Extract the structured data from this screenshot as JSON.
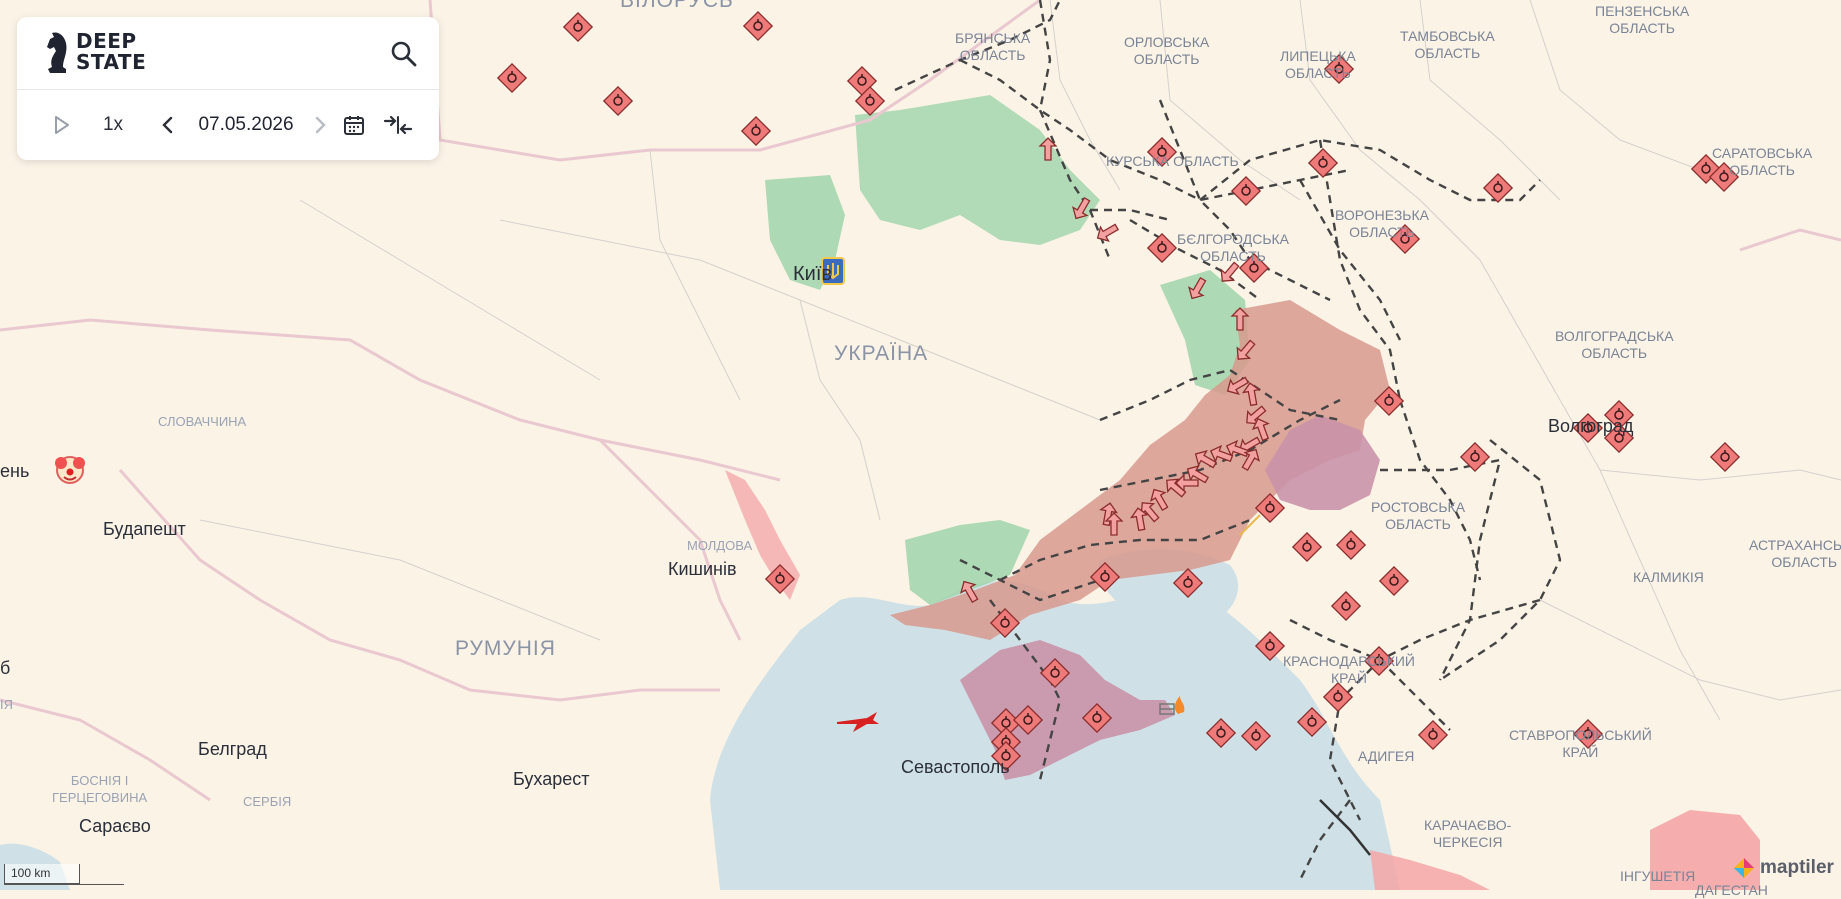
{
  "app": {
    "logo_line1": "DEEP",
    "logo_line2": "STATE"
  },
  "controls": {
    "speed": "1x",
    "date": "07.05.2026"
  },
  "labels": {
    "belarus": "ВІЛОРУСЬ",
    "bryansk": "БРЯНСЬКА\nОБЛАСТЬ",
    "orel": "ОРЛОВСЬКА\nОБЛАСТЬ",
    "lipetsk": "ЛИПЕЦЬКА\nОБЛАСТЬ",
    "tambov": "ТАМБОВСЬКА\nОБЛАСТЬ",
    "penza": "ПЕНЗЕНСЬКА\nОБЛАСТЬ",
    "kursk": "КУРСЬКА ОБЛАСТЬ",
    "saratov": "САРАТОВСЬКА\nОБЛАСТЬ",
    "voronezh": "ВОРОНЕЗЬКА\nОБЛАСТЬ",
    "belgorod": "БЄЛГОРОДСЬКА\nОБЛАСТЬ",
    "kyiv": "Київ",
    "ukraine": "УКРАЇНА",
    "volgograd_obl": "ВОЛГОГРАДСЬКА\nОБЛАСТЬ",
    "volgograd": "Волгоград",
    "slovakia": "СЛОВАЧЧИНА",
    "budapest": "Будапешт",
    "moldova": "МОЛДОВА",
    "chisinau": "Кишинів",
    "rostov": "РОСТОВСЬКА\nОБЛАСТЬ",
    "astrakhan": "АСТРАХАНСЬКА\nОБЛАСТЬ",
    "kalmykia": "КАЛМИКІЯ",
    "romania": "РУМУНІЯ",
    "krasnodar": "КРАСНОДАРСЬКИЙ\nКРАЙ",
    "stavropol": "СТАВРОПОЛЬСЬКИЙ\nКРАЙ",
    "adygea": "АДИГЕЯ",
    "belgrade": "Белград",
    "bosnia": "БОСНІЯ І\nГЕРЦЕГОВИНА",
    "serbia": "СЕРБІЯ",
    "bucharest": "Бухарест",
    "sevastopol": "Севастополь",
    "sarajevo": "Сараєво",
    "kchr": "КАРАЧАЄВО-\nЧЕРКЕСІЯ",
    "ingushetia": "ІНГУШЕТІЯ",
    "dagestan": "ДАГЕСТАН",
    "vienna_partial": "ень",
    "edge_b": "б",
    "edge_ia": "ІЯ"
  },
  "scale": {
    "label": "100 km"
  },
  "attribution": {
    "text": "maptiler"
  },
  "colors": {
    "land": "#fbf3e6",
    "sea": "#cfe1e6",
    "occupied": "#d8998d",
    "occupied_pre2022": "#c994a8",
    "liberated": "#9fd4aa",
    "marker": "#ef7a7a",
    "border": "#e9c8cf"
  }
}
